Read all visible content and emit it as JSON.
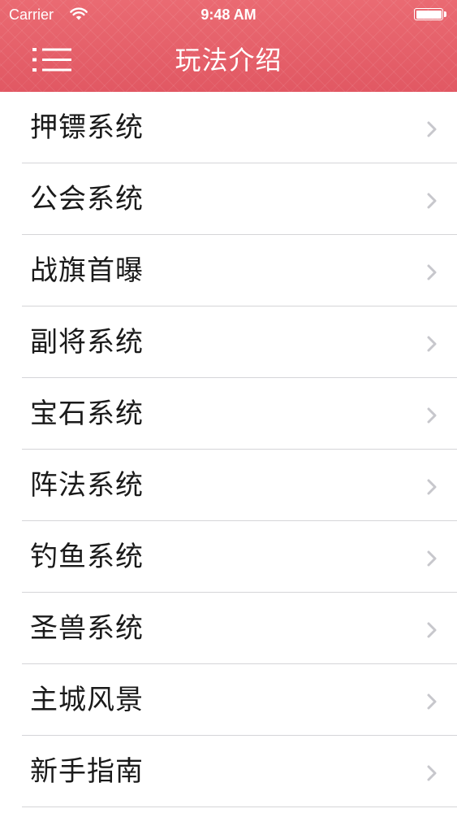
{
  "status_bar": {
    "carrier": "Carrier",
    "time": "9:48 AM"
  },
  "nav": {
    "title": "玩法介绍",
    "menu_icon": "menu-icon"
  },
  "colors": {
    "header": "#e35e68",
    "separator": "#d5d5d8",
    "chevron": "#c7c7cc",
    "text": "#1a1a1a"
  },
  "list": {
    "items": [
      {
        "label": "押镖系统"
      },
      {
        "label": "公会系统"
      },
      {
        "label": "战旗首曝"
      },
      {
        "label": "副将系统"
      },
      {
        "label": "宝石系统"
      },
      {
        "label": "阵法系统"
      },
      {
        "label": "钓鱼系统"
      },
      {
        "label": "圣兽系统"
      },
      {
        "label": "主城风景"
      },
      {
        "label": "新手指南"
      }
    ]
  }
}
